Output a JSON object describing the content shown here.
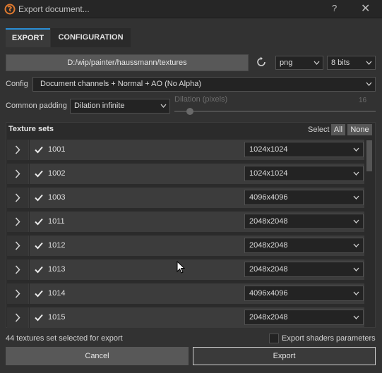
{
  "window": {
    "title": "Export document...",
    "help": "?",
    "close": "✕"
  },
  "tabs": [
    {
      "label": "EXPORT"
    },
    {
      "label": "CONFIGURATION"
    }
  ],
  "export_path": "D:/wip/painter/haussmann/textures",
  "format": {
    "value": "png"
  },
  "bits": {
    "value": "8 bits"
  },
  "config": {
    "label": "Config",
    "value": "Document channels + Normal + AO (No Alpha)"
  },
  "padding": {
    "label": "Common padding",
    "value": "Dilation infinite"
  },
  "dilation": {
    "label": "Dilation (pixels)",
    "value": "16",
    "fraction": 0.06
  },
  "texture_sets": {
    "title": "Texture sets",
    "select_label": "Select",
    "all_label": "All",
    "none_label": "None",
    "rows": [
      {
        "name": "1001",
        "size": "1024x1024",
        "checked": true
      },
      {
        "name": "1002",
        "size": "1024x1024",
        "checked": true
      },
      {
        "name": "1003",
        "size": "4096x4096",
        "checked": true
      },
      {
        "name": "1011",
        "size": "2048x2048",
        "checked": true
      },
      {
        "name": "1012",
        "size": "2048x2048",
        "checked": true
      },
      {
        "name": "1013",
        "size": "2048x2048",
        "checked": true
      },
      {
        "name": "1014",
        "size": "4096x4096",
        "checked": true
      },
      {
        "name": "1015",
        "size": "2048x2048",
        "checked": true
      }
    ]
  },
  "status": "44 textures set selected for export",
  "export_shaders": {
    "label": "Export shaders parameters",
    "checked": false
  },
  "buttons": {
    "cancel": "Cancel",
    "export": "Export"
  },
  "colors": {
    "accent": "#2a8fd6",
    "background": "#323232",
    "titlebar": "#262626"
  }
}
